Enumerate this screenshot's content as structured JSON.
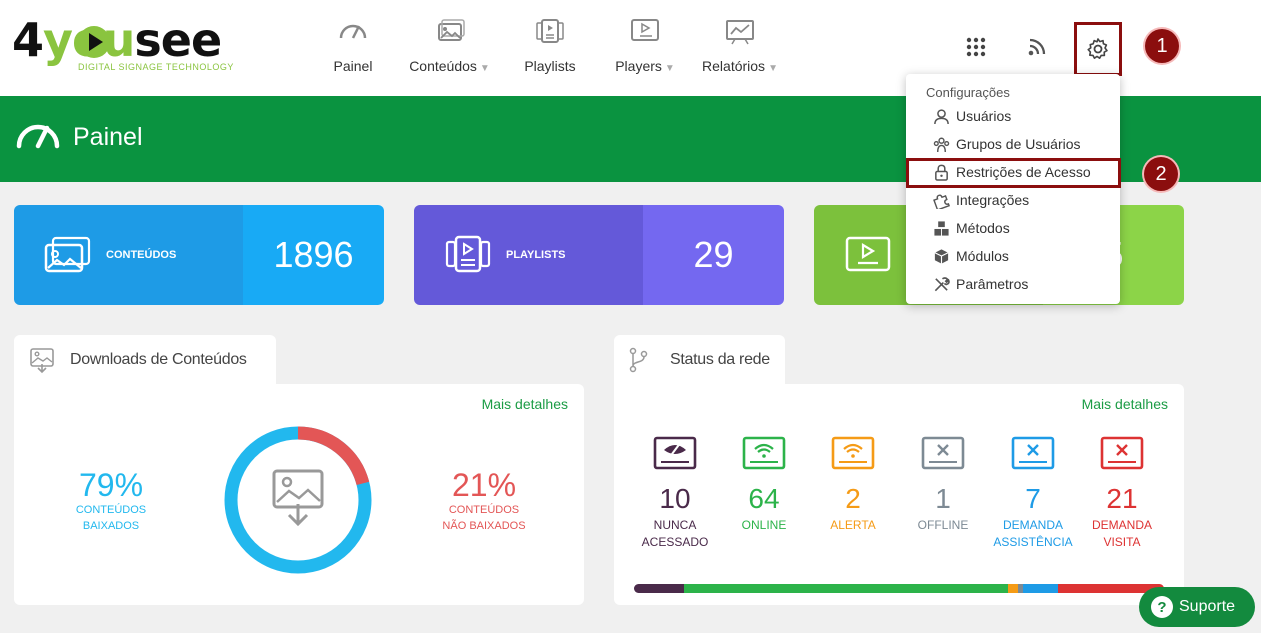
{
  "logo": {
    "brand_a": "4",
    "brand_b": "you",
    "brand_c": "see",
    "tagline": "DIGITAL SIGNAGE TECHNOLOGY"
  },
  "nav": [
    {
      "label": "Painel",
      "icon": "gauge-icon",
      "dropdown": false
    },
    {
      "label": "Conteúdos",
      "icon": "images-icon",
      "dropdown": true
    },
    {
      "label": "Playlists",
      "icon": "playlist-icon",
      "dropdown": false
    },
    {
      "label": "Players",
      "icon": "player-icon",
      "dropdown": true
    },
    {
      "label": "Relatórios",
      "icon": "report-icon",
      "dropdown": true
    }
  ],
  "steps": {
    "one": "1",
    "two": "2"
  },
  "page": {
    "title": "Painel"
  },
  "stats": [
    {
      "label": "CONTEÚDOS",
      "value": "1896",
      "color_left": "#1e9be6",
      "color_right": "#18aaf5"
    },
    {
      "label": "PLAYLISTS",
      "value": "29",
      "color_left": "#6459d9",
      "color_right": "#7468f0"
    },
    {
      "label": "",
      "value": "5",
      "color_left": "#7cc13c",
      "color_right": "#8cd448"
    }
  ],
  "downloads": {
    "title": "Downloads de Conteúdos",
    "more": "Mais detalhes",
    "downloaded": {
      "value": "79%",
      "l1": "CONTEÚDOS",
      "l2": "BAIXADOS",
      "fraction": 0.79,
      "color": "#22b8ee"
    },
    "not_downloaded": {
      "value": "21%",
      "l1": "CONTEÚDOS",
      "l2": "NÃO BAIXADOS",
      "fraction": 0.21,
      "color": "#e35656"
    }
  },
  "network": {
    "title": "Status da rede",
    "more": "Mais detalhes",
    "items": [
      {
        "num": "10",
        "l1": "NUNCA",
        "l2": "ACESSADO",
        "color": "#4a2a4a"
      },
      {
        "num": "64",
        "l1": "ONLINE",
        "l2": "",
        "color": "#2cb34a"
      },
      {
        "num": "2",
        "l1": "ALERTA",
        "l2": "",
        "color": "#f59b16"
      },
      {
        "num": "1",
        "l1": "OFFLINE",
        "l2": "",
        "color": "#7d8a94"
      },
      {
        "num": "7",
        "l1": "DEMANDA",
        "l2": "ASSISTÊNCIA",
        "color": "#1e9be6"
      },
      {
        "num": "21",
        "l1": "DEMANDA",
        "l2": "VISITA",
        "color": "#dd3333"
      }
    ]
  },
  "settings_menu": {
    "header": "Configurações",
    "items": [
      {
        "label": "Usuários",
        "icon": "user-icon"
      },
      {
        "label": "Grupos de Usuários",
        "icon": "users-group-icon"
      },
      {
        "label": "Restrições de Acesso",
        "icon": "lock-icon"
      },
      {
        "label": "Integrações",
        "icon": "puzzle-icon"
      },
      {
        "label": "Métodos",
        "icon": "cubes-icon"
      },
      {
        "label": "Módulos",
        "icon": "module-icon"
      },
      {
        "label": "Parâmetros",
        "icon": "tools-icon"
      }
    ]
  },
  "support": {
    "label": "Suporte"
  },
  "colors": {
    "green": "#0a9340",
    "highlight": "#8b0e0e"
  }
}
